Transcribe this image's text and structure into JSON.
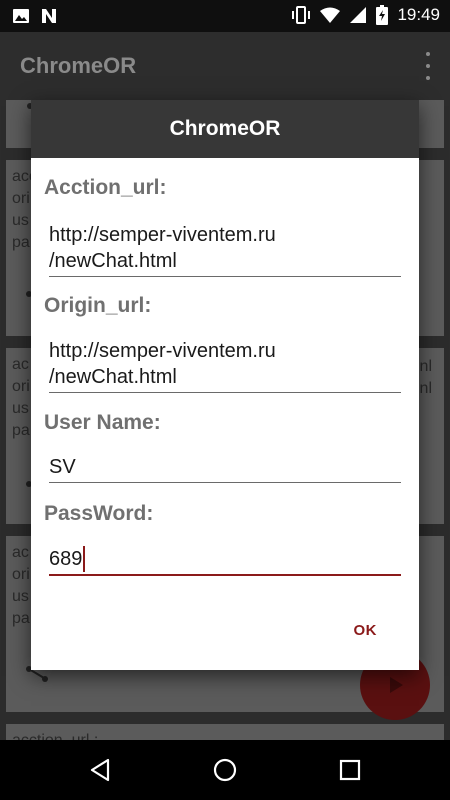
{
  "status_bar": {
    "time": "19:49",
    "left_icons": [
      "image-icon",
      "n-notification-icon"
    ],
    "right_icons": [
      "vibrate-icon",
      "wifi-icon",
      "signal-icon",
      "battery-icon"
    ]
  },
  "app_bar": {
    "title": "ChromeOR",
    "menu_icon": "overflow-menu-icon"
  },
  "background_cards": [
    {
      "lines": [
        "acc",
        "ori",
        "us",
        "pa"
      ],
      "right_lines": []
    },
    {
      "lines": [
        "ac",
        "ori",
        "us",
        "pa"
      ],
      "right_lines": [
        "nl",
        "nl"
      ]
    },
    {
      "lines": [
        "ac",
        "ori",
        "us",
        "pa"
      ],
      "right_lines": []
    },
    {
      "lines": [
        "acction_url :"
      ],
      "right_lines": []
    }
  ],
  "dialog": {
    "title": "ChromeOR",
    "fields": {
      "action_url": {
        "label": "Acction_url:",
        "value": "http://semper-viventem.ru\n/newChat.html"
      },
      "origin_url": {
        "label": "Origin_url:",
        "value": "http://semper-viventem.ru\n/newChat.html"
      },
      "user_name": {
        "label": "User Name:",
        "value": "SV"
      },
      "password": {
        "label": "PassWord:",
        "value": "689"
      }
    },
    "ok_label": "OK"
  },
  "colors": {
    "accent": "#8b1a1a",
    "dialog_header": "#373737",
    "fab": "#5a1010"
  }
}
